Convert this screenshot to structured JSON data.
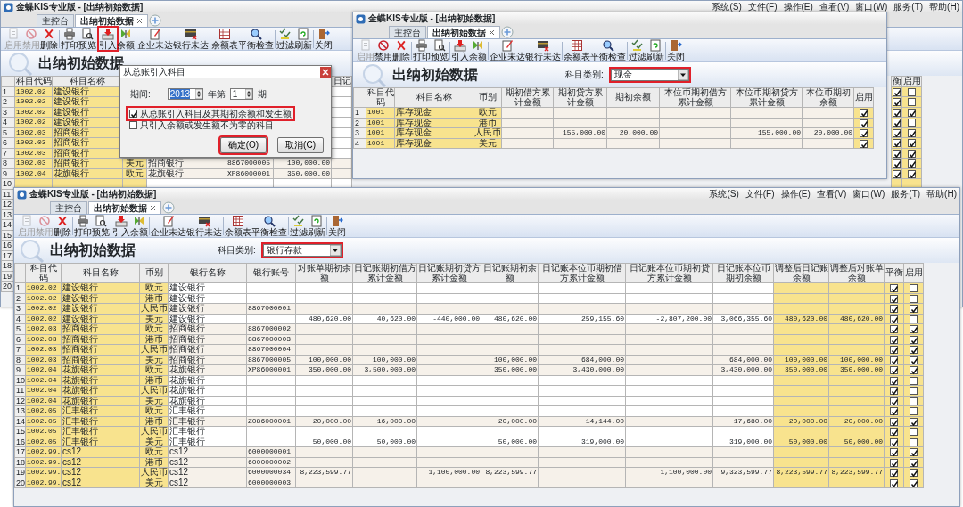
{
  "back_window": {
    "title": "金蝶KIS专业版 - [出纳初始数据]",
    "menu": [
      "系统(S)",
      "文件(F)",
      "操作(E)",
      "查看(V)",
      "窗口(W)",
      "服务(T)",
      "帮助(H)"
    ],
    "tabs": [
      {
        "label": "主控台",
        "selected": false
      },
      {
        "label": "出纳初始数据",
        "selected": true
      }
    ],
    "toolbar": [
      {
        "label": "启用",
        "disabled": true,
        "highlight": false
      },
      {
        "label": "禁用",
        "disabled": true,
        "highlight": false
      },
      {
        "label": "删除",
        "disabled": false,
        "highlight": false
      },
      {
        "label": "打印",
        "disabled": false,
        "highlight": false
      },
      {
        "label": "预览",
        "disabled": false,
        "highlight": false
      },
      {
        "label": "引入",
        "disabled": false,
        "highlight": true
      },
      {
        "label": "余额",
        "disabled": false,
        "highlight": false
      },
      {
        "label": "企业未达",
        "disabled": false,
        "highlight": false
      },
      {
        "label": "银行未达",
        "disabled": false,
        "highlight": false
      },
      {
        "label": "余额表",
        "disabled": false,
        "highlight": false
      },
      {
        "label": "平衡检查",
        "disabled": false,
        "highlight": false
      },
      {
        "label": "过滤",
        "disabled": false,
        "highlight": false
      },
      {
        "label": "刷新",
        "disabled": false,
        "highlight": false
      },
      {
        "label": "关闭",
        "disabled": false,
        "highlight": false
      }
    ],
    "heading": "出纳初始数据",
    "table": {
      "columns": [
        "科目代码",
        "科目名称",
        "日记",
        "衡",
        "启用"
      ],
      "rows": [
        {
          "number": "1",
          "code": "1002.02",
          "name": "建设银行",
          "balanced": true,
          "enabled": false
        },
        {
          "number": "2",
          "code": "1002.02",
          "name": "建设银行",
          "balanced": true,
          "enabled": false
        },
        {
          "number": "3",
          "code": "1002.02",
          "name": "建设银行",
          "balanced": true,
          "enabled": true
        },
        {
          "number": "4",
          "code": "1002.02",
          "name": "建设银行",
          "balanced": true,
          "enabled": false
        },
        {
          "number": "5",
          "code": "1002.03",
          "name": "招商银行",
          "balanced": true,
          "enabled": true
        },
        {
          "number": "6",
          "code": "1002.03",
          "name": "招商银行",
          "balanced": true,
          "enabled": true
        },
        {
          "number": "7",
          "code": "1002.03",
          "name": "招商银行",
          "balanced": true,
          "enabled": true
        },
        {
          "number": "8",
          "code": "1002.03",
          "name": "招商银行",
          "currency": "美元",
          "bank_name": "招商银行",
          "account_no": "8867000005",
          "statement_opening": "100,000.00",
          "balanced": true,
          "enabled": true
        },
        {
          "number": "9",
          "code": "1002.04",
          "name": "花旗银行",
          "currency": "欧元",
          "bank_name": "花旗银行",
          "account_no": "XP86000001",
          "statement_opening": "350,000.00",
          "balanced": true,
          "enabled": true
        },
        {
          "number": "10"
        },
        {
          "number": "11"
        },
        {
          "number": "12"
        },
        {
          "number": "13"
        },
        {
          "number": "14"
        },
        {
          "number": "15"
        },
        {
          "number": "16"
        },
        {
          "number": "17"
        },
        {
          "number": "18"
        },
        {
          "number": "19"
        },
        {
          "number": "20"
        }
      ]
    },
    "dialog": {
      "title": "从总账引入科目",
      "period_label": "期间:",
      "year": {
        "value": "2013",
        "selected": true
      },
      "year_suffix": "年第",
      "period": {
        "value": "1",
        "selected": false
      },
      "period_suffix": "期",
      "options": [
        {
          "label": "从总账引入科目及其期初余额和发生额",
          "checked": true,
          "highlight": true
        },
        {
          "label": "只引入余额或发生额不为零的科目",
          "checked": false,
          "highlight": false
        }
      ],
      "buttons": [
        {
          "label": "确定(O)",
          "highlight": true
        },
        {
          "label": "取消(C)",
          "highlight": false
        }
      ]
    }
  },
  "middle_window": {
    "title": "金蝶KIS专业版 - [出纳初始数据]",
    "tabs": [
      {
        "label": "主控台",
        "selected": false
      },
      {
        "label": "出纳初始数据",
        "selected": true
      }
    ],
    "toolbar": [
      {
        "label": "启用",
        "disabled": true
      },
      {
        "label": "禁用",
        "disabled": false
      },
      {
        "label": "删除",
        "disabled": false
      },
      {
        "label": "打印",
        "disabled": false
      },
      {
        "label": "预览",
        "disabled": false
      },
      {
        "label": "引入",
        "disabled": false
      },
      {
        "label": "余额",
        "disabled": false
      },
      {
        "label": "企业未达",
        "disabled": false
      },
      {
        "label": "银行未达",
        "disabled": false
      },
      {
        "label": "余额表",
        "disabled": false
      },
      {
        "label": "平衡检查",
        "disabled": false
      },
      {
        "label": "过滤",
        "disabled": false
      },
      {
        "label": "刷新",
        "disabled": false
      },
      {
        "label": "关闭",
        "disabled": false
      }
    ],
    "heading": "出纳初始数据",
    "category": {
      "label": "科目类别:",
      "value": "现金",
      "highlight": true
    },
    "table": {
      "columns": [
        "科目代码",
        "科目名称",
        "币别",
        "期初借方累计金额",
        "期初贷方累计金额",
        "期初余额",
        "本位币期初借方累计金额",
        "本位币期初贷方累计金额",
        "本位币期初余额",
        "启用"
      ],
      "rows": [
        {
          "number": "1",
          "code": "1001",
          "name": "库存现金",
          "currency": "欧元",
          "enabled": true
        },
        {
          "number": "2",
          "code": "1001",
          "name": "库存现金",
          "currency": "港币",
          "enabled": true
        },
        {
          "number": "3",
          "code": "1001",
          "name": "库存现金",
          "currency": "人民币",
          "credit": "155,000.00",
          "opening": "20,000.00",
          "base_credit": "155,000.00",
          "base_opening": "20,000.00",
          "enabled": true
        },
        {
          "number": "4",
          "code": "1001",
          "name": "库存现金",
          "currency": "美元",
          "enabled": true
        }
      ]
    }
  },
  "front_window": {
    "title": "金蝶KIS专业版 - [出纳初始数据]",
    "menu": [
      "系统(S)",
      "文件(F)",
      "操作(E)",
      "查看(V)",
      "窗口(W)",
      "服务(T)",
      "帮助(H)"
    ],
    "tabs": [
      {
        "label": "主控台",
        "selected": false
      },
      {
        "label": "出纳初始数据",
        "selected": true
      }
    ],
    "toolbar": [
      {
        "label": "启用",
        "disabled": true
      },
      {
        "label": "禁用",
        "disabled": true
      },
      {
        "label": "删除",
        "disabled": false
      },
      {
        "label": "打印",
        "disabled": false
      },
      {
        "label": "预览",
        "disabled": false
      },
      {
        "label": "引入",
        "disabled": false
      },
      {
        "label": "余额",
        "disabled": false
      },
      {
        "label": "企业未达",
        "disabled": false
      },
      {
        "label": "银行未达",
        "disabled": false
      },
      {
        "label": "余额表",
        "disabled": false
      },
      {
        "label": "平衡检查",
        "disabled": false
      },
      {
        "label": "过滤",
        "disabled": false
      },
      {
        "label": "刷新",
        "disabled": false
      },
      {
        "label": "关闭",
        "disabled": false
      }
    ],
    "heading": "出纳初始数据",
    "category": {
      "label": "科目类别:",
      "value": "银行存款",
      "highlight": true
    },
    "table": {
      "columns": [
        "科目代码",
        "科目名称",
        "币别",
        "银行名称",
        "银行账号",
        "对账单期初余额",
        "日记账期初借方累计金额",
        "日记账期初贷方累计金额",
        "日记账期初余额",
        "日记账本位币期初借方累计金额",
        "日记账本位币期初贷方累计金额",
        "日记账本位币期初余额",
        "调整后日记账余额",
        "调整后对账单余额",
        "平衡",
        "启用"
      ],
      "rows": [
        {
          "number": "1",
          "code": "1002.02",
          "name": "建设银行",
          "currency": "欧元",
          "bank_name": "建设银行",
          "balanced": true,
          "enabled": false
        },
        {
          "number": "2",
          "code": "1002.02",
          "name": "建设银行",
          "currency": "港币",
          "bank_name": "建设银行",
          "balanced": true,
          "enabled": false
        },
        {
          "number": "3",
          "code": "1002.02",
          "name": "建设银行",
          "currency": "人民币",
          "bank_name": "建设银行",
          "account_no": "8867000001",
          "balanced": true,
          "enabled": true
        },
        {
          "number": "4",
          "code": "1002.02",
          "name": "建设银行",
          "currency": "美元",
          "bank_name": "建设银行",
          "statement_opening": "480,620.00",
          "journal_debit": "40,620.00",
          "journal_credit": "-440,000.00",
          "journal_opening": "480,620.00",
          "base_debit": "259,155.60",
          "base_credit": "-2,807,200.00",
          "base_opening": "3,066,355.60",
          "adjusted_journal": "480,620.00",
          "adjusted_statement": "480,620.00",
          "balanced": true,
          "enabled": false
        },
        {
          "number": "5",
          "code": "1002.03",
          "name": "招商银行",
          "currency": "欧元",
          "bank_name": "招商银行",
          "account_no": "8867000002",
          "balanced": true,
          "enabled": true
        },
        {
          "number": "6",
          "code": "1002.03",
          "name": "招商银行",
          "currency": "港币",
          "bank_name": "招商银行",
          "account_no": "8867000003",
          "balanced": true,
          "enabled": true
        },
        {
          "number": "7",
          "code": "1002.03",
          "name": "招商银行",
          "currency": "人民币",
          "bank_name": "招商银行",
          "account_no": "8867000004",
          "balanced": true,
          "enabled": true
        },
        {
          "number": "8",
          "code": "1002.03",
          "name": "招商银行",
          "currency": "美元",
          "bank_name": "招商银行",
          "account_no": "8867000005",
          "statement_opening": "100,000.00",
          "journal_debit": "100,000.00",
          "journal_opening": "100,000.00",
          "base_debit": "684,000.00",
          "base_opening": "684,000.00",
          "adjusted_journal": "100,000.00",
          "adjusted_statement": "100,000.00",
          "balanced": true,
          "enabled": true
        },
        {
          "number": "9",
          "code": "1002.04",
          "name": "花旗银行",
          "currency": "欧元",
          "bank_name": "花旗银行",
          "account_no": "XP86000001",
          "statement_opening": "350,000.00",
          "journal_debit": "3,500,000.00",
          "journal_opening": "350,000.00",
          "base_debit": "3,430,000.00",
          "base_opening": "3,430,000.00",
          "adjusted_journal": "350,000.00",
          "adjusted_statement": "350,000.00",
          "balanced": true,
          "enabled": true
        },
        {
          "number": "10",
          "code": "1002.04",
          "name": "花旗银行",
          "currency": "港币",
          "bank_name": "花旗银行",
          "balanced": true,
          "enabled": false
        },
        {
          "number": "11",
          "code": "1002.04",
          "name": "花旗银行",
          "currency": "人民币",
          "bank_name": "花旗银行",
          "balanced": true,
          "enabled": false
        },
        {
          "number": "12",
          "code": "1002.04",
          "name": "花旗银行",
          "currency": "美元",
          "bank_name": "花旗银行",
          "balanced": true,
          "enabled": false
        },
        {
          "number": "13",
          "code": "1002.05",
          "name": "汇丰银行",
          "currency": "欧元",
          "bank_name": "汇丰银行",
          "balanced": true,
          "enabled": false
        },
        {
          "number": "14",
          "code": "1002.05",
          "name": "汇丰银行",
          "currency": "港币",
          "bank_name": "汇丰银行",
          "account_no": "Z086000001",
          "statement_opening": "20,000.00",
          "journal_debit": "16,000.00",
          "journal_opening": "20,000.00",
          "base_debit": "14,144.00",
          "base_opening": "17,680.00",
          "adjusted_journal": "20,000.00",
          "adjusted_statement": "20,000.00",
          "balanced": true,
          "enabled": true
        },
        {
          "number": "15",
          "code": "1002.05",
          "name": "汇丰银行",
          "currency": "人民币",
          "bank_name": "汇丰银行",
          "balanced": true,
          "enabled": false
        },
        {
          "number": "16",
          "code": "1002.05",
          "name": "汇丰银行",
          "currency": "美元",
          "bank_name": "汇丰银行",
          "statement_opening": "50,000.00",
          "journal_debit": "50,000.00",
          "journal_opening": "50,000.00",
          "base_debit": "319,000.00",
          "base_opening": "319,000.00",
          "adjusted_journal": "50,000.00",
          "adjusted_statement": "50,000.00",
          "balanced": true,
          "enabled": false
        },
        {
          "number": "17",
          "code": "1002.99.",
          "name": "cs12",
          "currency": "欧元",
          "bank_name": "cs12",
          "account_no": "6000000001",
          "balanced": true,
          "enabled": true
        },
        {
          "number": "18",
          "code": "1002.99.",
          "name": "cs12",
          "currency": "港币",
          "bank_name": "cs12",
          "account_no": "6000000002",
          "balanced": true,
          "enabled": true
        },
        {
          "number": "19",
          "code": "1002.99.",
          "name": "cs12",
          "currency": "人民币",
          "bank_name": "cs12",
          "account_no": "6000000034",
          "statement_opening": "8,223,599.77",
          "journal_credit": "1,100,000.00",
          "journal_opening": "8,223,599.77",
          "base_credit": "1,100,000.00",
          "base_opening": "9,323,599.77",
          "adjusted_journal": "8,223,599.77",
          "adjusted_statement": "8,223,599.77",
          "balanced": true,
          "enabled": true
        },
        {
          "number": "20",
          "code": "1002.99.",
          "name": "cs12",
          "currency": "美元",
          "bank_name": "cs12",
          "account_no": "6000000003",
          "balanced": true,
          "enabled": true
        }
      ]
    }
  }
}
